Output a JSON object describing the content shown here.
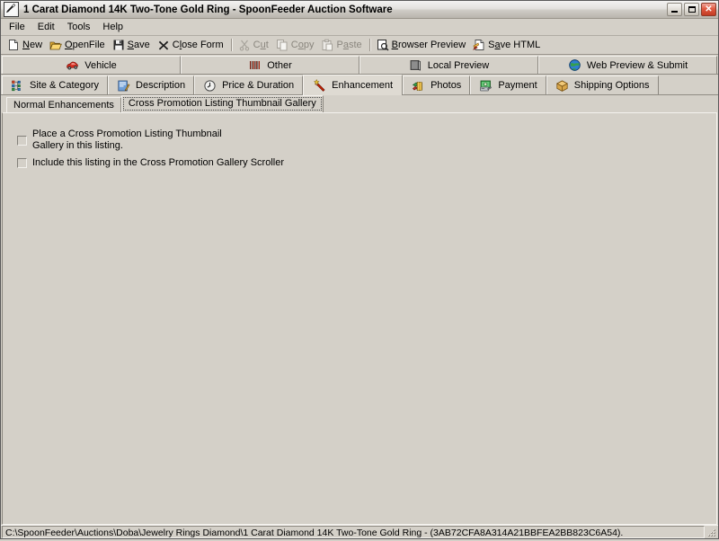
{
  "window": {
    "title": "1 Carat Diamond 14K Two-Tone Gold Ring - SpoonFeeder Auction Software",
    "icon": "pen-icon",
    "controls": {
      "minimize": "minimize-button",
      "maximize": "maximize-button",
      "close_label": "✕"
    }
  },
  "menu": {
    "items": [
      {
        "label": "File"
      },
      {
        "label": "Edit"
      },
      {
        "label": "Tools"
      },
      {
        "label": "Help"
      }
    ]
  },
  "toolbar": {
    "buttons": [
      {
        "pre": "",
        "accel": "N",
        "post": "ew",
        "icon": "new-document-icon",
        "enabled": true
      },
      {
        "pre": "",
        "accel": "O",
        "post": "penFile",
        "icon": "open-folder-icon",
        "enabled": true
      },
      {
        "pre": "",
        "accel": "S",
        "post": "ave",
        "icon": "floppy-disk-icon",
        "enabled": true
      },
      {
        "pre": "C",
        "accel": "l",
        "post": "ose Form",
        "icon": "close-x-icon",
        "enabled": true
      },
      {
        "pre": "C",
        "accel": "u",
        "post": "t",
        "icon": "scissors-icon",
        "enabled": false
      },
      {
        "pre": "C",
        "accel": "o",
        "post": "py",
        "icon": "copy-icon",
        "enabled": false
      },
      {
        "pre": "P",
        "accel": "a",
        "post": "ste",
        "icon": "paste-icon",
        "enabled": false
      },
      {
        "pre": "",
        "accel": "B",
        "post": "rowser Preview",
        "icon": "browser-preview-icon",
        "enabled": true
      },
      {
        "pre": "S",
        "accel": "a",
        "post": "ve HTML",
        "icon": "save-html-icon",
        "enabled": true
      }
    ]
  },
  "tabs_primary": [
    {
      "label": "Vehicle",
      "icon": "car-icon",
      "selected": false
    },
    {
      "label": "Other",
      "icon": "barcode-icon",
      "selected": false
    },
    {
      "label": "Local Preview",
      "icon": "monitor-icon",
      "selected": false
    },
    {
      "label": "Web Preview & Submit",
      "icon": "globe-icon",
      "selected": false
    }
  ],
  "tabs_secondary": [
    {
      "label": "Site & Category",
      "icon": "tree-icon",
      "selected": false
    },
    {
      "label": "Description",
      "icon": "notepad-pencil-icon",
      "selected": false
    },
    {
      "label": "Price & Duration",
      "icon": "clock-icon",
      "selected": false
    },
    {
      "label": "Enhancement",
      "icon": "magic-wand-icon",
      "selected": true
    },
    {
      "label": "Photos",
      "icon": "film-roll-icon",
      "selected": false
    },
    {
      "label": "Payment",
      "icon": "payment-card-icon",
      "selected": false
    },
    {
      "label": "Shipping Options",
      "icon": "package-box-icon",
      "selected": false
    }
  ],
  "subtabs": [
    {
      "label": "Normal Enhancements",
      "selected": false
    },
    {
      "label": "Cross Promotion Listing Thumbnail Gallery",
      "selected": true
    }
  ],
  "content": {
    "checkboxes": [
      {
        "label": "Place a Cross Promotion Listing Thumbnail\nGallery in this listing.",
        "checked": false
      },
      {
        "label": "Include this listing in the Cross Promotion Gallery Scroller",
        "checked": false
      }
    ]
  },
  "status": {
    "path": "C:\\SpoonFeeder\\Auctions\\Doba\\Jewelry Rings Diamond\\1 Carat Diamond 14K Two-Tone Gold Ring - (3AB72CFA8A314A21BBFEA2BB823C6A54)."
  },
  "colors": {
    "face": "#d4d0c8",
    "close_red": "#e05a42",
    "accent_yellow": "#f2c14b",
    "wand_red": "#cc2200"
  }
}
